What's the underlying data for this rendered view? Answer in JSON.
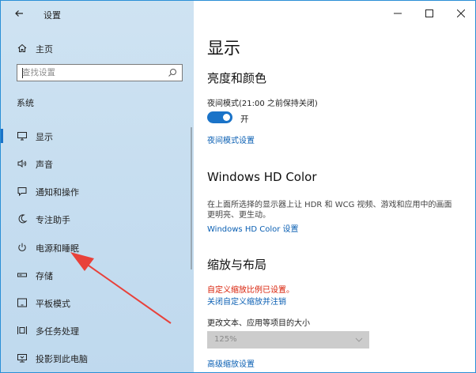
{
  "window": {
    "title": "设置",
    "controls": {
      "minimize": "—",
      "maximize": "☐",
      "close": "✕"
    }
  },
  "sidebar": {
    "home_label": "主页",
    "search_placeholder": "查找设置",
    "section": "系统",
    "items": [
      {
        "label": "显示",
        "icon": "monitor-icon",
        "selected": true
      },
      {
        "label": "声音",
        "icon": "speaker-icon"
      },
      {
        "label": "通知和操作",
        "icon": "notification-icon"
      },
      {
        "label": "专注助手",
        "icon": "moon-icon"
      },
      {
        "label": "电源和睡眠",
        "icon": "power-icon"
      },
      {
        "label": "存储",
        "icon": "storage-icon"
      },
      {
        "label": "平板模式",
        "icon": "tablet-icon"
      },
      {
        "label": "多任务处理",
        "icon": "multitasking-icon"
      },
      {
        "label": "投影到此电脑",
        "icon": "projector-icon"
      }
    ]
  },
  "main": {
    "title": "显示",
    "brightness": {
      "heading": "亮度和颜色",
      "night_mode_label": "夜间模式(21:00 之前保持关闭)",
      "toggle_state": "开",
      "night_mode_link": "夜间模式设置"
    },
    "hd_color": {
      "heading": "Windows HD Color",
      "description_line1": "在上面所选择的显示器上让 HDR 和 WCG 视频、游戏和应用中的画面",
      "description_line2": "更明亮、更生动。",
      "link": "Windows HD Color 设置"
    },
    "scale": {
      "heading": "缩放与布局",
      "warning": "自定义缩放比例已设置。",
      "disable_link": "关闭自定义缩放并注销",
      "size_label": "更改文本、应用等项目的大小",
      "size_value": "125%",
      "advanced_link": "高级缩放设置"
    }
  },
  "colors": {
    "accent": "#1a73c8",
    "link": "#0a5fb3",
    "warning": "#d81e06",
    "annotation_arrow": "#e8413a"
  }
}
